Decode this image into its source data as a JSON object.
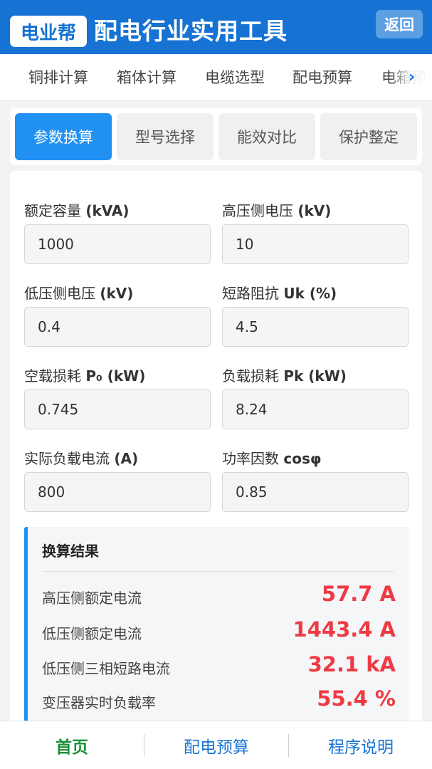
{
  "header": {
    "logo": "电业帮",
    "title": "配电行业实用工具",
    "back_label": "返回"
  },
  "topnav": {
    "items": [
      "铜排计算",
      "箱体计算",
      "电缆选型",
      "配电预算",
      "电箱预"
    ],
    "arrow": "›"
  },
  "subtabs": [
    "参数换算",
    "型号选择",
    "能效对比",
    "保护整定"
  ],
  "form": {
    "fields": [
      {
        "label": "额定容量 ",
        "unit": "(kVA)",
        "value": "1000"
      },
      {
        "label": "高压侧电压 ",
        "unit": "(kV)",
        "value": "10"
      },
      {
        "label": "低压侧电压 ",
        "unit": "(kV)",
        "value": "0.4"
      },
      {
        "label": "短路阻抗 ",
        "unit": "Uk (%)",
        "value": "4.5"
      },
      {
        "label": "空载损耗 ",
        "unit": "P₀ (kW)",
        "value": "0.745"
      },
      {
        "label": "负载损耗 ",
        "unit": "Pk (kW)",
        "value": "8.24"
      },
      {
        "label": "实际负载电流 ",
        "unit": "(A)",
        "value": "800"
      },
      {
        "label": "功率因数 ",
        "unit": "cosφ",
        "value": "0.85"
      }
    ]
  },
  "results": {
    "title": "换算结果",
    "rows": [
      {
        "label": "高压侧额定电流",
        "value": "57.7 A"
      },
      {
        "label": "低压侧额定电流",
        "value": "1443.4 A"
      },
      {
        "label": "低压侧三相短路电流",
        "value": "32.1 kA"
      },
      {
        "label": "变压器实时负载率",
        "value": "55.4 %"
      }
    ],
    "value_color": "#ee3b43"
  },
  "bottom": {
    "tabs": [
      "首页",
      "配电预算",
      "程序说明"
    ]
  },
  "colors": {
    "primary": "#1673d3",
    "accent": "#2091f3",
    "active_home": "#1c8f3a"
  }
}
